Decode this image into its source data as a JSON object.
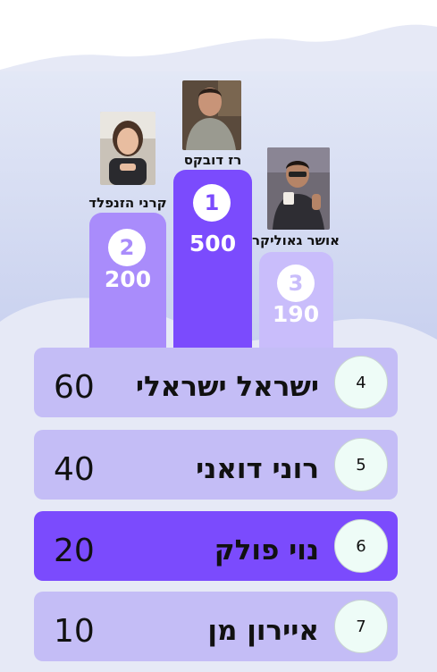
{
  "podium": [
    {
      "place": "1",
      "name": "רז דובקס",
      "score": "500",
      "icon": "person-photo-man-hoodie"
    },
    {
      "place": "2",
      "name": "קרני הזנפלד",
      "score": "200",
      "icon": "person-photo-woman"
    },
    {
      "place": "3",
      "name": "אושר גאוליקר",
      "score": "190",
      "icon": "person-photo-man-thumbsup"
    }
  ],
  "list": [
    {
      "rank": "4",
      "name": "ישראל ישראלי",
      "score": "60"
    },
    {
      "rank": "5",
      "name": "רוני דואני",
      "score": "40"
    },
    {
      "rank": "6",
      "name": "נוי פולק",
      "score": "20"
    },
    {
      "rank": "7",
      "name": "איירון מן",
      "score": "10"
    }
  ],
  "colors": {
    "first": "#7b4bfd",
    "second": "#a98cfb",
    "third": "#c9bdfb",
    "row": "#c4bdf6",
    "row_highlight": "#7b4bfd",
    "background": "#e6e9f6"
  }
}
